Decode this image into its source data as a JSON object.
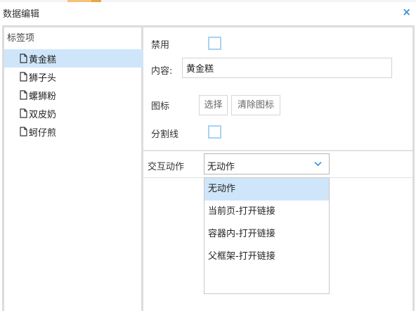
{
  "dialog": {
    "title": "数据编辑",
    "close_glyph": "×"
  },
  "tree": {
    "header": "标签项",
    "items": [
      {
        "label": "黄金糕",
        "selected": true
      },
      {
        "label": "狮子头",
        "selected": false
      },
      {
        "label": "螺狮粉",
        "selected": false
      },
      {
        "label": "双皮奶",
        "selected": false
      },
      {
        "label": "蚵仔煎",
        "selected": false
      }
    ]
  },
  "form": {
    "disabled_label": "禁用",
    "disabled_checked": false,
    "content_label": "内容:",
    "content_value": "黄金糕",
    "icon_label": "图标",
    "select_icon_button": "选择",
    "clear_icon_button": "清除图标",
    "divider_label": "分割线",
    "divider_checked": false,
    "action_label": "交互动作",
    "action_value": "无动作"
  },
  "dropdown": {
    "options": [
      {
        "label": "无动作",
        "selected": true
      },
      {
        "label": "当前页-打开链接",
        "selected": false
      },
      {
        "label": "容器内-打开链接",
        "selected": false
      },
      {
        "label": "父框架-打开链接",
        "selected": false
      }
    ]
  },
  "colors": {
    "accent": "#3d8fd8",
    "selection": "#cfe6fa",
    "checkbox_border": "#a9d2f3",
    "top_strip_segments": [
      "#f6c27a",
      "#e8a64a"
    ]
  },
  "icons": {
    "tree_item": "file-icon",
    "select_arrow": "chevron-down-icon",
    "close": "close-icon"
  }
}
